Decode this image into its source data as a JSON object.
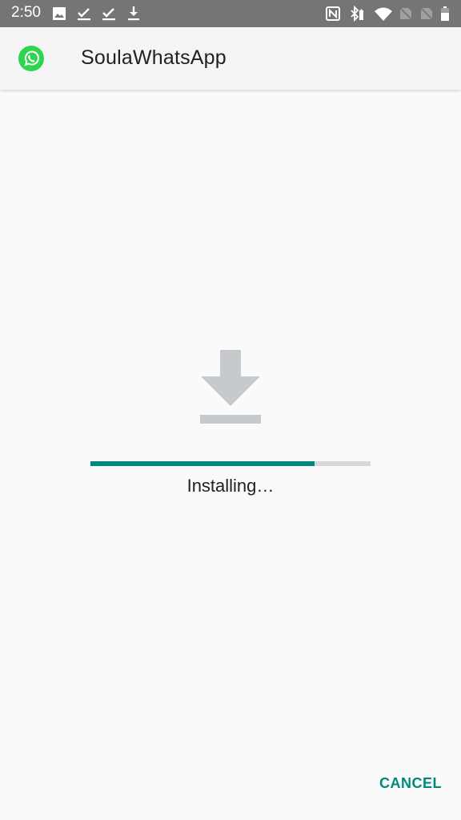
{
  "status_bar": {
    "time": "2:50",
    "left_icons": [
      "image-icon",
      "check-download-icon",
      "check-download-icon",
      "download-icon"
    ],
    "right_icons": [
      "nfc-icon",
      "bluetooth-battery-icon",
      "wifi-icon",
      "no-sim-icon",
      "no-sim-icon",
      "battery-icon"
    ]
  },
  "app_bar": {
    "icon": "whatsapp-logo-icon",
    "title": "SoulaWhatsApp"
  },
  "main": {
    "icon": "download-icon",
    "progress": 0.8,
    "status": "Installing…"
  },
  "actions": {
    "cancel_label": "CANCEL"
  },
  "colors": {
    "accent": "#00897b",
    "whatsapp_green": "#2fd44f",
    "icon_gray": "#c7cacd",
    "track": "#d8d8d8"
  }
}
